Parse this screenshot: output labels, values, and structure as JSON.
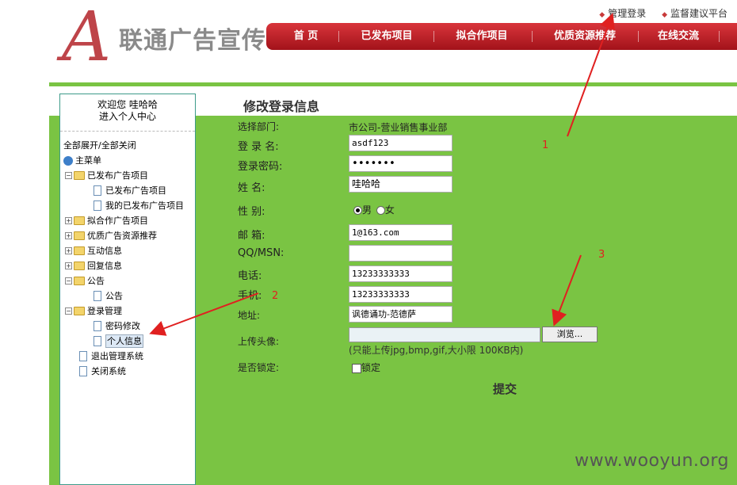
{
  "header": {
    "logo_letter": "A",
    "logo_text": "联通广告宣传",
    "top_links": [
      "管理登录",
      "监督建议平台"
    ],
    "nav": [
      "首 页",
      "已发布项目",
      "拟合作项目",
      "优质资源推荐",
      "在线交流"
    ]
  },
  "sidebar": {
    "welcome_line1": "欢迎您  哇哈哈",
    "welcome_line2": "进入个人中心",
    "expand_toggle": "全部展开/全部关闭",
    "root": "主菜单",
    "items": [
      {
        "label": "已发布广告项目",
        "type": "folder-open"
      },
      {
        "label": "已发布广告项目",
        "type": "page"
      },
      {
        "label": "我的已发布广告项目",
        "type": "page"
      },
      {
        "label": "拟合作广告项目",
        "type": "folder"
      },
      {
        "label": "优质广告资源推荐",
        "type": "folder"
      },
      {
        "label": "互动信息",
        "type": "folder"
      },
      {
        "label": "回复信息",
        "type": "folder"
      },
      {
        "label": "公告",
        "type": "folder-open"
      },
      {
        "label": "公告",
        "type": "page"
      },
      {
        "label": "登录管理",
        "type": "folder-open"
      },
      {
        "label": "密码修改",
        "type": "page"
      },
      {
        "label": "个人信息",
        "type": "page"
      },
      {
        "label": "退出管理系统",
        "type": "page"
      },
      {
        "label": "关闭系统",
        "type": "page"
      }
    ]
  },
  "form": {
    "title": "修改登录信息",
    "department_label": "选择部门:",
    "department_value": "市公司-营业销售事业部",
    "username_label": "登 录 名:",
    "username_value": "asdf123",
    "password_label": "登录密码:",
    "password_value": "•••••••",
    "name_label": "姓  名:",
    "name_value": "哇哈哈",
    "gender_label": "性  别:",
    "gender_male": "男",
    "gender_female": "女",
    "email_label": "邮 箱:",
    "email_value": "1@163.com",
    "qq_label": "QQ/MSN:",
    "qq_value": "",
    "phone_label": "电话:",
    "phone_value": "13233333333",
    "mobile_label": "手机:",
    "mobile_value": "13233333333",
    "address_label": "地址:",
    "address_value": "讽德诵功-范德萨",
    "avatar_label": "上传头像:",
    "browse_label": "浏览...",
    "avatar_hint": "(只能上传jpg,bmp,gif,大小限 100KB内)",
    "lock_label": "是否锁定:",
    "lock_checkbox_label": "锁定",
    "submit_label": "提交"
  },
  "annotations": [
    "1",
    "2",
    "3"
  ],
  "colors": {
    "accent_green": "#7ac443",
    "nav_red": "#c0242b",
    "annotation_red": "#e02020"
  },
  "watermark": "www.wooyun.org"
}
